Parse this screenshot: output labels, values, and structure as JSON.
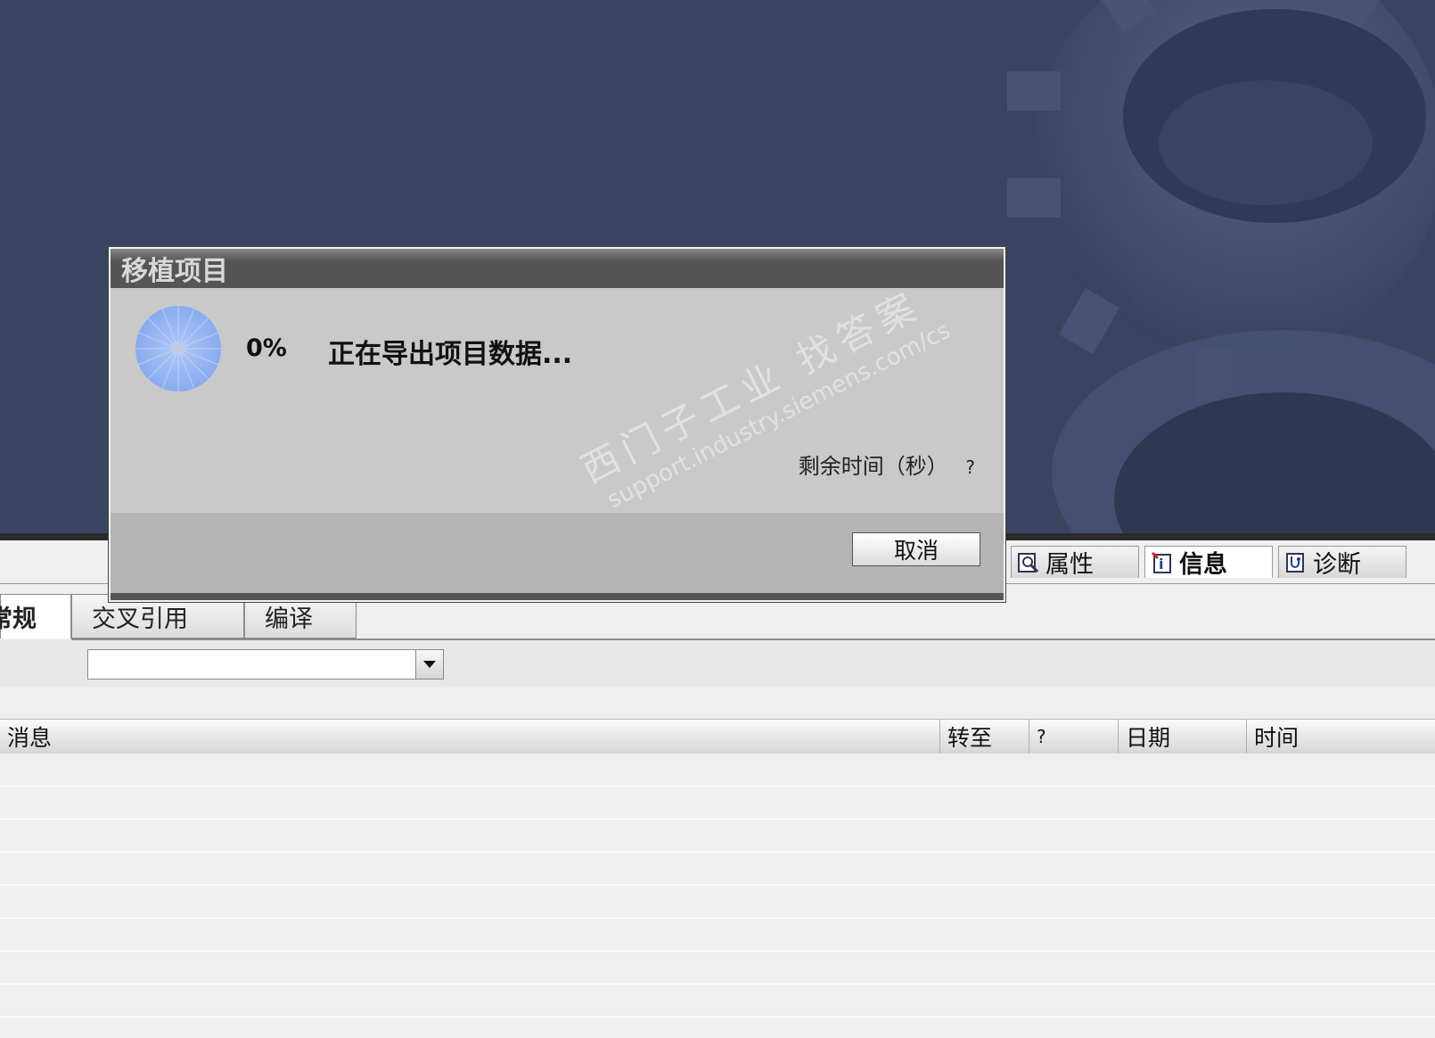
{
  "dialog": {
    "title": "移植项目",
    "percent": "0%",
    "status": "正在导出项目数据...",
    "remaining_label": "剩余时间（秒）",
    "remaining_value": "?",
    "cancel_label": "取消"
  },
  "inspector_tabs": [
    {
      "label": "属性",
      "icon": "properties-icon"
    },
    {
      "label": "信息",
      "icon": "info-icon",
      "active": true
    },
    {
      "label": "诊断",
      "icon": "diagnostics-icon"
    }
  ],
  "sub_tabs": [
    "常规",
    "交叉引用",
    "编译"
  ],
  "filter": {
    "value": ""
  },
  "table": {
    "columns": [
      "消息",
      "转至",
      "?",
      "日期",
      "时间"
    ]
  },
  "watermark": {
    "line1": "西门子工业  找答案",
    "line2": "support.industry.siemens.com/cs"
  }
}
